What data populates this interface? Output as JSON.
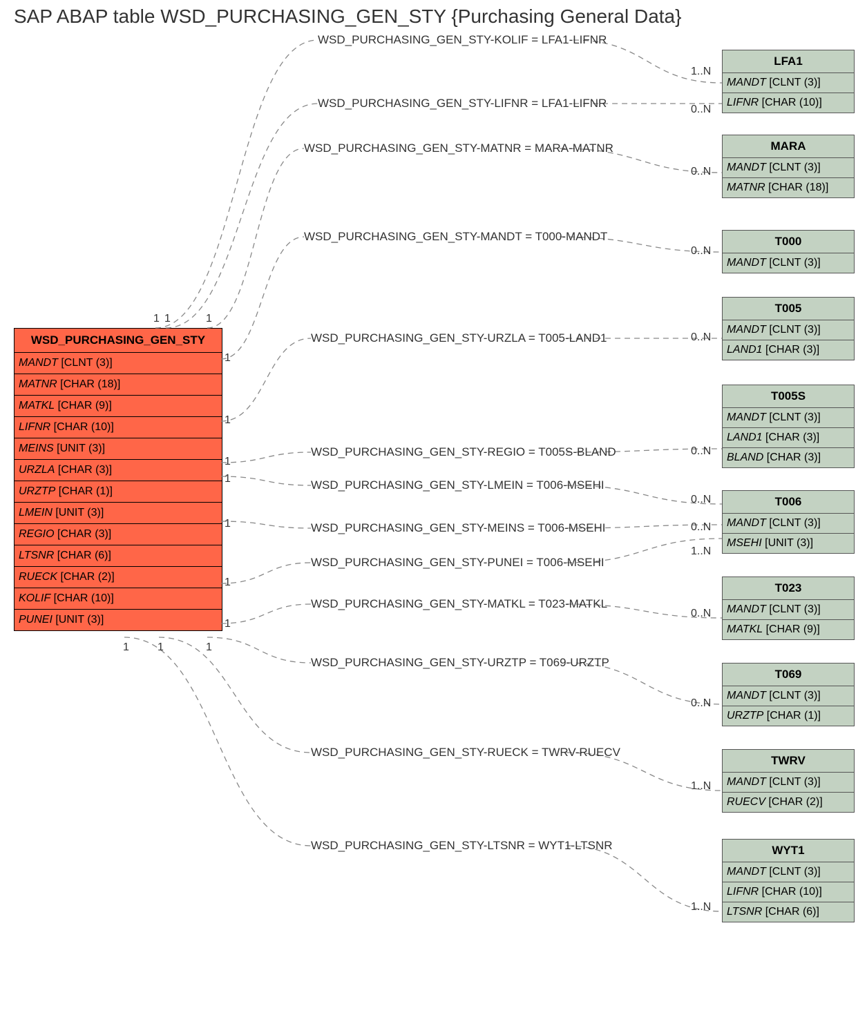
{
  "title": "SAP ABAP table WSD_PURCHASING_GEN_STY {Purchasing General Data}",
  "main": {
    "name": "WSD_PURCHASING_GEN_STY",
    "fields": [
      {
        "f": "MANDT",
        "t": "[CLNT (3)]"
      },
      {
        "f": "MATNR",
        "t": "[CHAR (18)]"
      },
      {
        "f": "MATKL",
        "t": "[CHAR (9)]"
      },
      {
        "f": "LIFNR",
        "t": "[CHAR (10)]"
      },
      {
        "f": "MEINS",
        "t": "[UNIT (3)]"
      },
      {
        "f": "URZLA",
        "t": "[CHAR (3)]"
      },
      {
        "f": "URZTP",
        "t": "[CHAR (1)]"
      },
      {
        "f": "LMEIN",
        "t": "[UNIT (3)]"
      },
      {
        "f": "REGIO",
        "t": "[CHAR (3)]"
      },
      {
        "f": "LTSNR",
        "t": "[CHAR (6)]"
      },
      {
        "f": "RUECK",
        "t": "[CHAR (2)]"
      },
      {
        "f": "KOLIF",
        "t": "[CHAR (10)]"
      },
      {
        "f": "PUNEI",
        "t": "[UNIT (3)]"
      }
    ]
  },
  "targets": [
    {
      "name": "LFA1",
      "fields": [
        {
          "f": "MANDT",
          "t": "[CLNT (3)]"
        },
        {
          "f": "LIFNR",
          "t": "[CHAR (10)]"
        }
      ]
    },
    {
      "name": "MARA",
      "fields": [
        {
          "f": "MANDT",
          "t": "[CLNT (3)]"
        },
        {
          "f": "MATNR",
          "t": "[CHAR (18)]"
        }
      ]
    },
    {
      "name": "T000",
      "fields": [
        {
          "f": "MANDT",
          "t": "[CLNT (3)]"
        }
      ]
    },
    {
      "name": "T005",
      "fields": [
        {
          "f": "MANDT",
          "t": "[CLNT (3)]"
        },
        {
          "f": "LAND1",
          "t": "[CHAR (3)]"
        }
      ]
    },
    {
      "name": "T005S",
      "fields": [
        {
          "f": "MANDT",
          "t": "[CLNT (3)]"
        },
        {
          "f": "LAND1",
          "t": "[CHAR (3)]"
        },
        {
          "f": "BLAND",
          "t": "[CHAR (3)]"
        }
      ]
    },
    {
      "name": "T006",
      "fields": [
        {
          "f": "MANDT",
          "t": "[CLNT (3)]"
        },
        {
          "f": "MSEHI",
          "t": "[UNIT (3)]"
        }
      ]
    },
    {
      "name": "T023",
      "fields": [
        {
          "f": "MANDT",
          "t": "[CLNT (3)]"
        },
        {
          "f": "MATKL",
          "t": "[CHAR (9)]"
        }
      ]
    },
    {
      "name": "T069",
      "fields": [
        {
          "f": "MANDT",
          "t": "[CLNT (3)]"
        },
        {
          "f": "URZTP",
          "t": "[CHAR (1)]"
        }
      ]
    },
    {
      "name": "TWRV",
      "fields": [
        {
          "f": "MANDT",
          "t": "[CLNT (3)]"
        },
        {
          "f": "RUECV",
          "t": "[CHAR (2)]"
        }
      ]
    },
    {
      "name": "WYT1",
      "fields": [
        {
          "f": "MANDT",
          "t": "[CLNT (3)]"
        },
        {
          "f": "LIFNR",
          "t": "[CHAR (10)]"
        },
        {
          "f": "LTSNR",
          "t": "[CHAR (6)]"
        }
      ]
    }
  ],
  "relations": [
    {
      "label": "WSD_PURCHASING_GEN_STY-KOLIF = LFA1-LIFNR",
      "card_src": "1",
      "card_tgt": "1..N"
    },
    {
      "label": "WSD_PURCHASING_GEN_STY-LIFNR = LFA1-LIFNR",
      "card_src": "1",
      "card_tgt": "0..N"
    },
    {
      "label": "WSD_PURCHASING_GEN_STY-MATNR = MARA-MATNR",
      "card_src": "1",
      "card_tgt": "0..N"
    },
    {
      "label": "WSD_PURCHASING_GEN_STY-MANDT = T000-MANDT",
      "card_src": "1",
      "card_tgt": "0..N"
    },
    {
      "label": "WSD_PURCHASING_GEN_STY-URZLA = T005-LAND1",
      "card_src": "1",
      "card_tgt": "0..N"
    },
    {
      "label": "WSD_PURCHASING_GEN_STY-REGIO = T005S-BLAND",
      "card_src": "1",
      "card_tgt": "0..N"
    },
    {
      "label": "WSD_PURCHASING_GEN_STY-LMEIN = T006-MSEHI",
      "card_src": "1",
      "card_tgt": "0..N"
    },
    {
      "label": "WSD_PURCHASING_GEN_STY-MEINS = T006-MSEHI",
      "card_src": "1",
      "card_tgt": "0..N"
    },
    {
      "label": "WSD_PURCHASING_GEN_STY-PUNEI = T006-MSEHI",
      "card_src": "1",
      "card_tgt": "1..N"
    },
    {
      "label": "WSD_PURCHASING_GEN_STY-MATKL = T023-MATKL",
      "card_src": "1",
      "card_tgt": "0..N"
    },
    {
      "label": "WSD_PURCHASING_GEN_STY-URZTP = T069-URZTP",
      "card_src": "1",
      "card_tgt": "0..N"
    },
    {
      "label": "WSD_PURCHASING_GEN_STY-RUECK = TWRV-RUECV",
      "card_src": "1",
      "card_tgt": "1..N"
    },
    {
      "label": "WSD_PURCHASING_GEN_STY-LTSNR = WYT1-LTSNR",
      "card_src": "1",
      "card_tgt": "1..N"
    }
  ]
}
